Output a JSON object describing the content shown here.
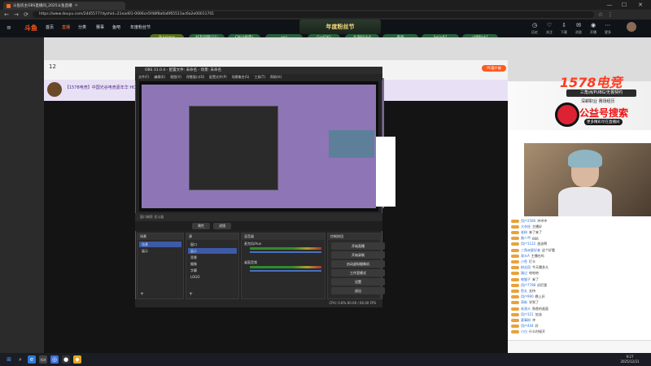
{
  "browser": {
    "tab_title": "斗鱼房主OBS直播间_2025斗鱼直播",
    "url": "https://www.douyu.com/2445577?dyshid=21ead01-0006ce5f48f8a0a6f65511ac6a2e00011701",
    "window_controls": [
      "—",
      "☐",
      "✕"
    ]
  },
  "douyu": {
    "logo": "斗鱼",
    "nav": [
      "首页",
      "直播",
      "分类",
      "赛事",
      "鱼吧",
      "年度粉丝节"
    ],
    "banner": "年度粉丝节",
    "topics_row1": [
      "Ruixiang",
      "好友团圆(21)",
      "CNU(经典)",
      "xyz",
      "GodDIO",
      "大海Bilibili",
      "黄昏",
      "Selin87",
      "小明Bak1"
    ],
    "topics_row2": [
      "小婆",
      "无忧城市",
      "小狗狐狸",
      "我不会不知(CW)"
    ],
    "header_icons": [
      {
        "icon": "history-icon",
        "label": "历史"
      },
      {
        "icon": "follow-icon",
        "label": "关注"
      },
      {
        "icon": "download-icon",
        "label": "下载"
      },
      {
        "icon": "message-icon",
        "label": "消息"
      },
      {
        "icon": "live-icon",
        "label": "开播"
      },
      {
        "icon": "more-icon",
        "label": "更多"
      }
    ],
    "room": {
      "fans_count": "12",
      "room_title": "【1578电竞】中国光谷电竞嘉年华 HORIZON",
      "pc_tag": "PC客户端"
    }
  },
  "promo": {
    "brand": "1578电竞",
    "tagline": "三角洲/PUBG/无畏契约",
    "sub": "深耕职业 赛场经历",
    "headline": "公益号搜索",
    "footer": "更多精彩尽在直播间"
  },
  "chat": {
    "lines": [
      {
        "name": "用户2580",
        "text": "冲冲冲"
      },
      {
        "name": "大杂烩",
        "text": "主播好"
      },
      {
        "name": "老粉",
        "text": "来了来了"
      },
      {
        "name": "路人甲",
        "text": "666"
      },
      {
        "name": "用户1122",
        "text": "加油啊"
      },
      {
        "name": "三角洲爱好者",
        "text": "这个好看"
      },
      {
        "name": "观众A",
        "text": "主播在吗"
      },
      {
        "name": "小鱼",
        "text": "打卡"
      },
      {
        "name": "粉丝团",
        "text": "今天播多久"
      },
      {
        "name": "路过",
        "text": "哈哈哈"
      },
      {
        "name": "夜猫子",
        "text": "来了"
      },
      {
        "name": "用户7788",
        "text": "好厉害"
      },
      {
        "name": "鱼丸",
        "text": "支持"
      },
      {
        "name": "用户990",
        "text": "晚上好"
      },
      {
        "name": "萌新",
        "text": "学到了"
      },
      {
        "name": "老观众",
        "text": "熟悉的画面"
      },
      {
        "name": "用户321",
        "text": "加油"
      },
      {
        "name": "赛事粉",
        "text": "冲"
      },
      {
        "name": "用户444",
        "text": "好"
      },
      {
        "name": "小白",
        "text": "什么时候开"
      }
    ]
  },
  "obs": {
    "title": "OBS 31.0.4 - 配置文件: 未命名 - 场景: 未命名",
    "menu": [
      "文件(F)",
      "编辑(E)",
      "视图(V)",
      "停靠窗口(D)",
      "配置文件(P)",
      "场景集合(S)",
      "工具(T)",
      "帮助(H)"
    ],
    "source_bar": "窗口捕获 显示器",
    "trans_buttons": [
      "属性",
      "滤镜"
    ],
    "docks": {
      "scenes": {
        "title": "场景",
        "items": [
          "场景",
          "展示"
        ]
      },
      "sources": {
        "title": "源",
        "items": [
          "窗口",
          "展示",
          "背景",
          "摄像",
          "字幕",
          "LOGO"
        ]
      },
      "mixer": {
        "title": "混音器",
        "channels": [
          "麦克风/Aux",
          "桌面音频"
        ]
      },
      "transitions": {
        "title": "转场动画"
      },
      "controls": {
        "title": "控制按钮",
        "buttons": [
          "开始直播",
          "开始录制",
          "启动虚拟摄像机",
          "工作室模式",
          "设置",
          "退出"
        ]
      }
    },
    "status": "CPU: 0.8%   60.00 / 60.00 FPS"
  },
  "taskbar": {
    "time": "9:27",
    "date": "2025/12/31"
  }
}
